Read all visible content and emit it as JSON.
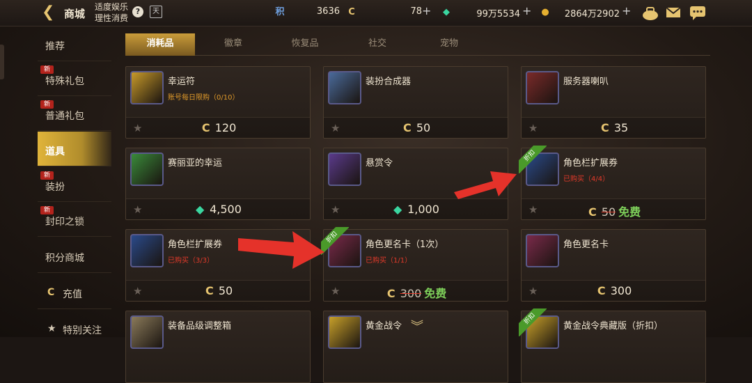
{
  "header": {
    "title": "商城",
    "subtitle": "适度娱乐理性消费",
    "help": "?",
    "calendar": "天"
  },
  "currencies": [
    {
      "icon": "积",
      "value": "3636",
      "color": "#6fa0e0"
    },
    {
      "icon": "C",
      "value": "78",
      "color": "#e6c470"
    },
    {
      "icon": "◆",
      "value": "99万5534",
      "color": "#3ad6a0"
    },
    {
      "icon": "●",
      "value": "2864万2902",
      "color": "#e6b030"
    }
  ],
  "sidebar": {
    "items": [
      {
        "label": "推荐",
        "new": ""
      },
      {
        "label": "特殊礼包",
        "new": "新"
      },
      {
        "label": "普通礼包",
        "new": "新"
      },
      {
        "label": "道具",
        "new": ""
      },
      {
        "label": "装扮",
        "new": "新"
      },
      {
        "label": "封印之锁",
        "new": "新"
      },
      {
        "label": "积分商城",
        "new": ""
      },
      {
        "label": "充值",
        "new": ""
      },
      {
        "label": "特别关注",
        "new": ""
      }
    ]
  },
  "tabs": [
    "消耗品",
    "徽章",
    "恢复品",
    "社交",
    "宠物"
  ],
  "cards": [
    {
      "name": "幸运符",
      "sub": "账号每日限购（0/10）",
      "sub_class": "orange",
      "currency": "C",
      "old": "",
      "price": "120",
      "free": "",
      "ribbon": ""
    },
    {
      "name": "装扮合成器",
      "sub": "",
      "sub_class": "",
      "currency": "C",
      "old": "",
      "price": "50",
      "free": "",
      "ribbon": ""
    },
    {
      "name": "服务器喇叭",
      "sub": "",
      "sub_class": "",
      "currency": "C",
      "old": "",
      "price": "35",
      "free": "",
      "ribbon": ""
    },
    {
      "name": "赛丽亚的幸运",
      "sub": "",
      "sub_class": "",
      "currency": "◆",
      "old": "",
      "price": "4,500",
      "free": "",
      "ribbon": ""
    },
    {
      "name": "悬赏令",
      "sub": "",
      "sub_class": "",
      "currency": "◆",
      "old": "",
      "price": "1,000",
      "free": "",
      "ribbon": ""
    },
    {
      "name": "角色栏扩展券",
      "sub": "已购买（4/4）",
      "sub_class": "red",
      "currency": "C",
      "old": "50",
      "price": "",
      "free": "免费",
      "ribbon": "折扣"
    },
    {
      "name": "角色栏扩展券",
      "sub": "已购买（3/3）",
      "sub_class": "red",
      "currency": "C",
      "old": "",
      "price": "50",
      "free": "",
      "ribbon": ""
    },
    {
      "name": "角色更名卡（1次）",
      "sub": "已购买（1/1）",
      "sub_class": "red",
      "currency": "C",
      "old": "300",
      "price": "",
      "free": "免费",
      "ribbon": "折扣"
    },
    {
      "name": "角色更名卡",
      "sub": "",
      "sub_class": "",
      "currency": "C",
      "old": "",
      "price": "300",
      "free": "",
      "ribbon": ""
    },
    {
      "name": "装备品级调整箱",
      "sub": "",
      "sub_class": "",
      "currency": "",
      "old": "",
      "price": "",
      "free": "",
      "ribbon": ""
    },
    {
      "name": "黄金战令",
      "sub": "",
      "sub_class": "",
      "currency": "",
      "old": "",
      "price": "",
      "free": "",
      "ribbon": ""
    },
    {
      "name": "黄金战令典藏版（折扣）",
      "sub": "",
      "sub_class": "",
      "currency": "",
      "old": "",
      "price": "",
      "free": "",
      "ribbon": "折扣"
    }
  ],
  "colors": {
    "accent": "#e6c470",
    "active_tab": "#c99c3a",
    "red_arrow": "#e5322a",
    "free": "#7ed05a"
  }
}
